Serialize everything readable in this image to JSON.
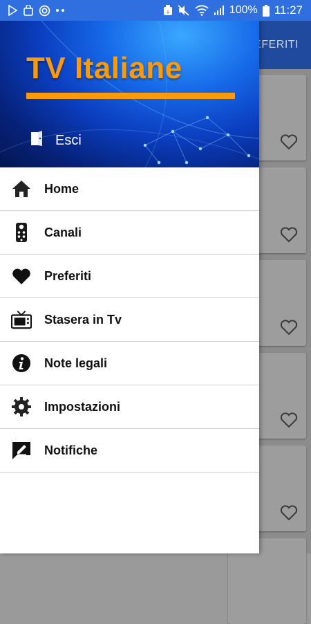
{
  "status_bar": {
    "battery_percent": "100%",
    "time": "11:27",
    "icons": [
      "play-store-icon",
      "shopping-bag-icon",
      "target-icon",
      "more-dots-icon",
      "alarm-icon",
      "mute-icon",
      "wifi-icon",
      "signal-icon",
      "battery-icon"
    ]
  },
  "background_app": {
    "toolbar_title": "PREFERITI",
    "toolbar_color": "#1f4a9e",
    "card_icon": "heart-outline-icon"
  },
  "drawer": {
    "logo_text": "TV Italiane",
    "logo_color": "#ff9a05",
    "logout_label": "Esci",
    "logout_icon": "exit-door-icon",
    "items": [
      {
        "label": "Home",
        "icon": "home-icon"
      },
      {
        "label": "Canali",
        "icon": "remote-control-icon"
      },
      {
        "label": "Preferiti",
        "icon": "heart-icon"
      },
      {
        "label": "Stasera in Tv",
        "icon": "tv-icon"
      },
      {
        "label": "Note legali",
        "icon": "info-icon"
      },
      {
        "label": "Impostazioni",
        "icon": "gear-icon"
      },
      {
        "label": "Notifiche",
        "icon": "notification-edit-icon"
      }
    ]
  }
}
